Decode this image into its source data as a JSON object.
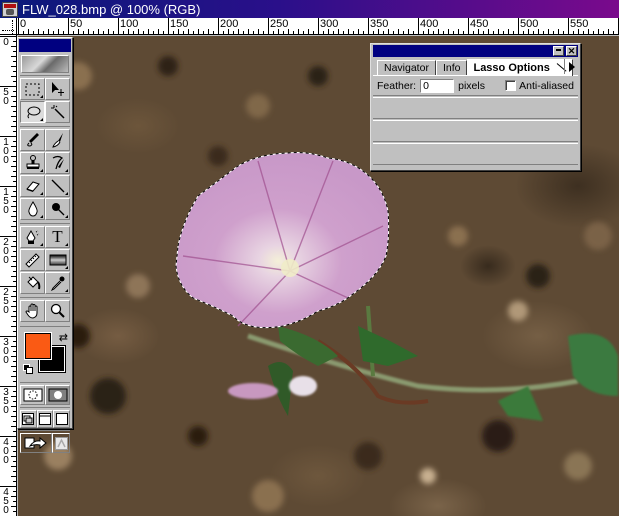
{
  "window": {
    "title": "FLW_028.bmp @ 100% (RGB)"
  },
  "rulers": {
    "horizontal_labels": [
      "0",
      "50",
      "100",
      "150",
      "200",
      "250",
      "300",
      "350",
      "400",
      "450",
      "500",
      "550"
    ],
    "vertical_labels": [
      "0",
      "50",
      "100",
      "150",
      "200",
      "250",
      "300",
      "350",
      "400",
      "450"
    ],
    "unit": "pixels"
  },
  "toolbox": {
    "tools": [
      {
        "name": "marquee-tool",
        "icon": "dashed-rectangle",
        "has_more": true
      },
      {
        "name": "move-tool",
        "icon": "arrow-with-crosshair",
        "has_more": false
      },
      {
        "name": "lasso-tool",
        "icon": "lasso",
        "has_more": true,
        "selected": true
      },
      {
        "name": "magic-wand-tool",
        "icon": "magic-wand",
        "has_more": false
      },
      {
        "name": "airbrush-tool",
        "icon": "airbrush",
        "has_more": false
      },
      {
        "name": "paintbrush-tool",
        "icon": "paintbrush",
        "has_more": false
      },
      {
        "name": "rubber-stamp-tool",
        "icon": "stamp",
        "has_more": true
      },
      {
        "name": "history-brush-tool",
        "icon": "history-brush",
        "has_more": true
      },
      {
        "name": "eraser-tool",
        "icon": "eraser",
        "has_more": true
      },
      {
        "name": "pencil-tool",
        "icon": "pencil-line",
        "has_more": true
      },
      {
        "name": "blur-tool",
        "icon": "water-drop",
        "has_more": true
      },
      {
        "name": "dodge-tool",
        "icon": "dodge-lollipop",
        "has_more": true
      },
      {
        "name": "pen-tool",
        "icon": "pen-nib",
        "has_more": true
      },
      {
        "name": "type-tool",
        "icon": "T",
        "has_more": true
      },
      {
        "name": "measure-tool",
        "icon": "ruler",
        "has_more": false
      },
      {
        "name": "gradient-tool",
        "icon": "gradient-bar",
        "has_more": true
      },
      {
        "name": "paint-bucket-tool",
        "icon": "paint-bucket",
        "has_more": false
      },
      {
        "name": "eyedropper-tool",
        "icon": "eyedropper",
        "has_more": true
      },
      {
        "name": "hand-tool",
        "icon": "hand",
        "has_more": false
      },
      {
        "name": "zoom-tool",
        "icon": "magnifier",
        "has_more": false
      }
    ],
    "type_glyph": "T",
    "foreground_color": "#fa5a14",
    "background_color": "#000000"
  },
  "palette": {
    "tabs": [
      {
        "label": "Navigator",
        "active": false
      },
      {
        "label": "Info",
        "active": false
      },
      {
        "label": "Lasso Options",
        "active": true
      }
    ],
    "feather_label": "Feather:",
    "feather_value": "0",
    "feather_unit": "pixels",
    "anti_aliased_label": "Anti-aliased",
    "anti_aliased_checked": false
  },
  "image": {
    "subject": "pink bindweed flower on soil",
    "selection": "lasso marching-ants around flower"
  }
}
